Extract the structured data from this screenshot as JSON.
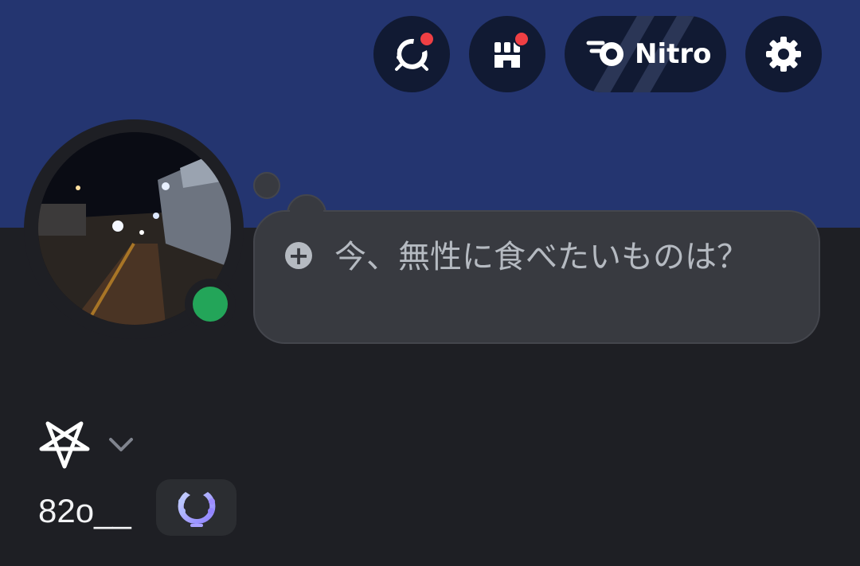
{
  "profile": {
    "username": "82o__",
    "status": "online",
    "status_color": "#23a559",
    "banner_color": "#243570"
  },
  "header": {
    "buttons": [
      {
        "icon": "quests-laurel-icon",
        "notification": true
      },
      {
        "icon": "shop-icon",
        "notification": true
      },
      {
        "icon": "nitro-icon",
        "label": "Nitro"
      },
      {
        "icon": "gear-icon"
      }
    ]
  },
  "custom_status": {
    "prompt": "今、無性に食べたいものは？",
    "icon": "plus-icon"
  },
  "display_name": {
    "icon": "pentagram-icon",
    "dropdown_icon": "chevron-down-icon"
  },
  "badges": [
    {
      "icon": "laurel-badge-icon"
    }
  ],
  "colors": {
    "background": "#1e1f24",
    "accent_red": "#ef3f44",
    "bubble": "#383a40"
  }
}
